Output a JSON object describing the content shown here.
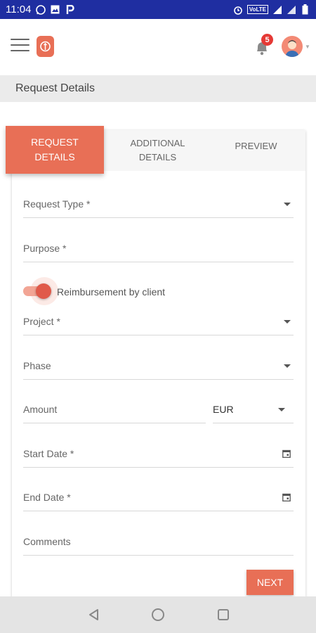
{
  "status_bar": {
    "time": "11:04",
    "network_label": "VoLTE",
    "icons": [
      "whatsapp-icon",
      "image-icon",
      "parking-icon",
      "alarm-icon",
      "signal-icon",
      "battery-icon"
    ]
  },
  "header": {
    "notification_count": "5",
    "accent_color": "#e86f56"
  },
  "page": {
    "title": "Request Details"
  },
  "tabs": [
    {
      "label": "REQUEST DETAILS",
      "active": true
    },
    {
      "label": "ADDITIONAL DETAILS",
      "active": false
    },
    {
      "label": "PREVIEW",
      "active": false
    }
  ],
  "form": {
    "request_type_label": "Request Type *",
    "purpose_label": "Purpose *",
    "reimbursement_label": "Reimbursement by client",
    "reimbursement_on": true,
    "project_label": "Project *",
    "phase_label": "Phase",
    "amount_label": "Amount",
    "currency_value": "EUR",
    "start_date_label": "Start Date *",
    "end_date_label": "End Date *",
    "comments_label": "Comments",
    "next_label": "NEXT"
  }
}
